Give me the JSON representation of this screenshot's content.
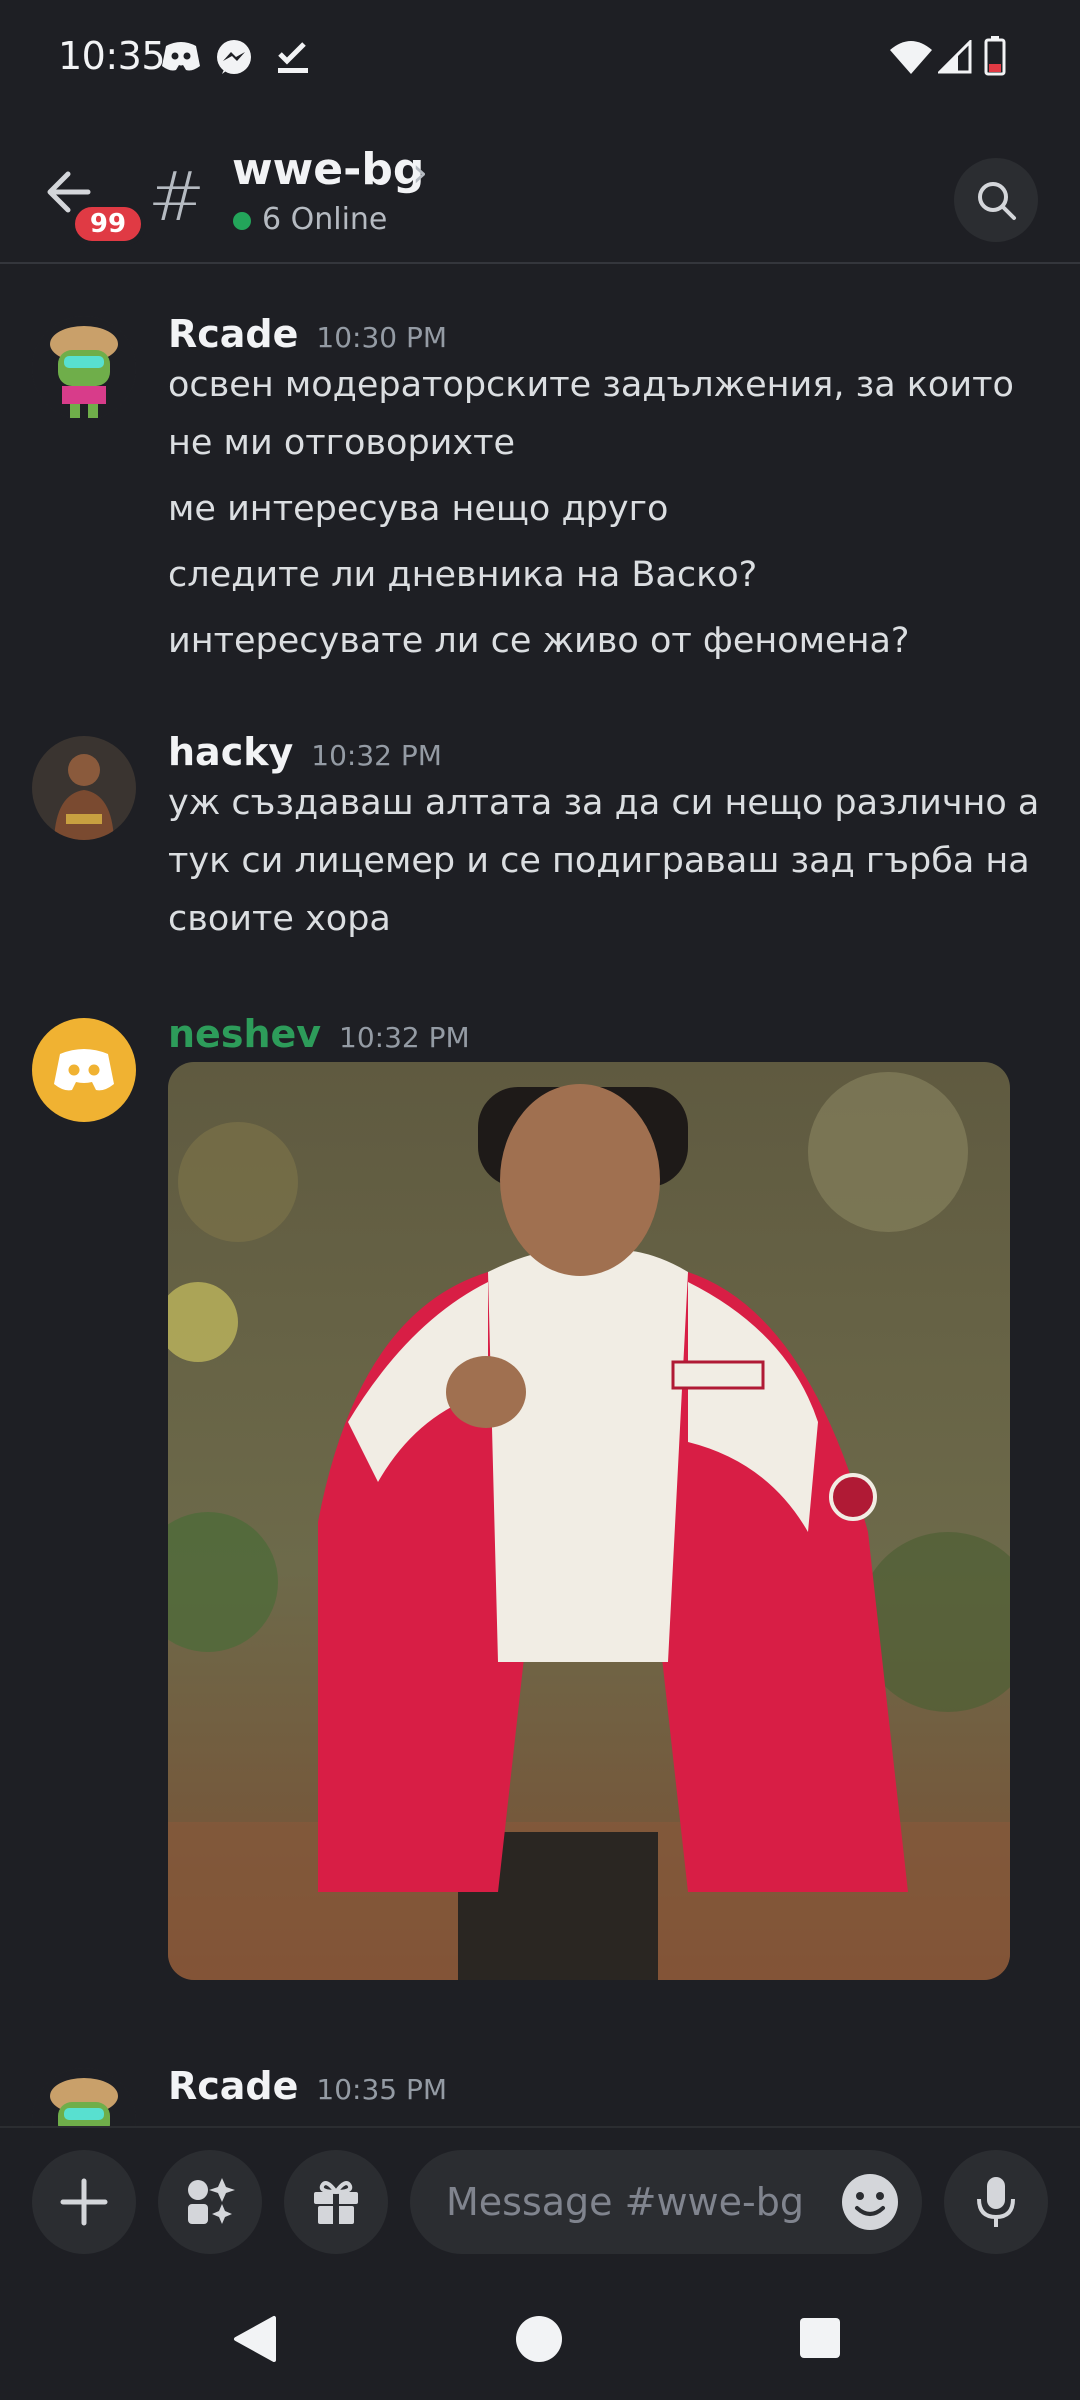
{
  "status": {
    "time": "10:35"
  },
  "header": {
    "badge": "99",
    "channel_name": "wwe-bg",
    "online_text": "6 Online"
  },
  "messages": [
    {
      "author": "Rcade",
      "time": "10:30 PM",
      "lines": [
        "освен модераторските задължения, за които",
        "не ми отговорихте",
        "ме интересува нещо друго",
        "следите ли дневника на Васко?",
        "интересувате ли се живо от феномена?"
      ]
    },
    {
      "author": "hacky",
      "time": "10:32 PM",
      "lines": [
        "уж създаваш алтата за да си нещо различно а",
        "тук си лицемер и се подиграваш зад гърба на",
        "своите хора"
      ]
    },
    {
      "author": "neshev",
      "time": "10:32 PM",
      "attachment": "photo"
    },
    {
      "author": "Rcade",
      "time": "10:35 PM"
    }
  ],
  "composer": {
    "placeholder": "Message #wwe-bg"
  },
  "colors": {
    "accent_green": "#2d9c5a",
    "badge_red": "#e03a44",
    "discord_orange": "#f0b232"
  }
}
